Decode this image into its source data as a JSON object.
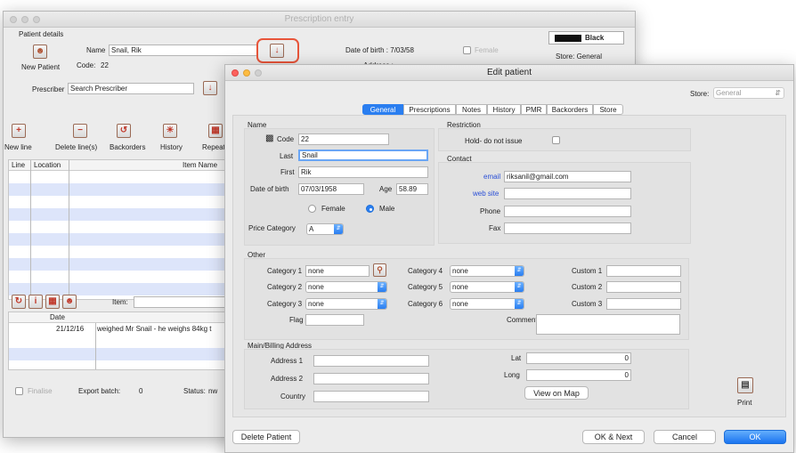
{
  "back_window": {
    "title": "Prescription entry",
    "patient_details_label": "Patient details",
    "name_label": "Name",
    "name_value": "Snail, Rik",
    "new_patient_label": "New Patient",
    "code_label": "Code:",
    "code_value": "22",
    "dob_label": "Date of birth : 7/03/58",
    "female_label": "Female",
    "color_label": "Black",
    "store_label": "Store: General",
    "address_label": "Address :",
    "prescriber_label": "Prescriber",
    "prescriber_value": "Search Prescriber",
    "toolbar": {
      "new_line": "New line",
      "delete_lines": "Delete line(s)",
      "backorders": "Backorders",
      "history": "History",
      "repeats": "Repeats"
    },
    "columns": [
      "Line",
      "Location",
      "Item Name"
    ],
    "item_label": "Item:",
    "history_date_header": "Date",
    "history_row": {
      "date": "21/12/16",
      "note": "weighed Mr Snail - he weighs 84kg t"
    },
    "finalise_label": "Finalise",
    "export_batch_label": "Export batch:",
    "export_batch_value": "0",
    "status_label": "Status:",
    "status_value": "nw"
  },
  "edit_window": {
    "title": "Edit patient",
    "store_label": "Store:",
    "store_value": "General",
    "tabs": [
      "General",
      "Prescriptions",
      "Notes",
      "History",
      "PMR",
      "Backorders",
      "Store"
    ],
    "name_section": {
      "title": "Name",
      "code_label": "Code",
      "code_value": "22",
      "last_label": "Last",
      "last_value": "Snail",
      "first_label": "First",
      "first_value": "Rik",
      "dob_label": "Date of birth",
      "dob_value": "07/03/1958",
      "age_label": "Age",
      "age_value": "58.89",
      "female_label": "Female",
      "male_label": "Male",
      "price_category_label": "Price Category",
      "price_category_value": "A"
    },
    "restriction": {
      "title": "Restriction",
      "hold_label": "Hold- do not issue"
    },
    "contact": {
      "title": "Contact",
      "email_label": "email",
      "email_value": "riksanil@gmail.com",
      "web_label": "web site",
      "web_value": "",
      "phone_label": "Phone",
      "phone_value": "",
      "fax_label": "Fax",
      "fax_value": ""
    },
    "other": {
      "title": "Other",
      "category1_label": "Category 1",
      "category1_value": "none",
      "category2_label": "Category 2",
      "category2_value": "none",
      "category3_label": "Category 3",
      "category3_value": "none",
      "category4_label": "Category 4",
      "category4_value": "none",
      "category5_label": "Category 5",
      "category5_value": "none",
      "category6_label": "Category 6",
      "category6_value": "none",
      "flag_label": "Flag",
      "flag_value": "",
      "custom1_label": "Custom 1",
      "custom2_label": "Custom 2",
      "custom3_label": "Custom 3",
      "comment_label": "Comment"
    },
    "address": {
      "title": "Main/Billing Address",
      "address1_label": "Address 1",
      "address2_label": "Address 2",
      "country_label": "Country",
      "lat_label": "Lat",
      "lat_value": "0",
      "long_label": "Long",
      "long_value": "0",
      "view_map_label": "View on Map"
    },
    "print_label": "Print",
    "buttons": {
      "delete_patient": "Delete Patient",
      "ok_next": "OK & Next",
      "cancel": "Cancel",
      "ok": "OK"
    }
  }
}
